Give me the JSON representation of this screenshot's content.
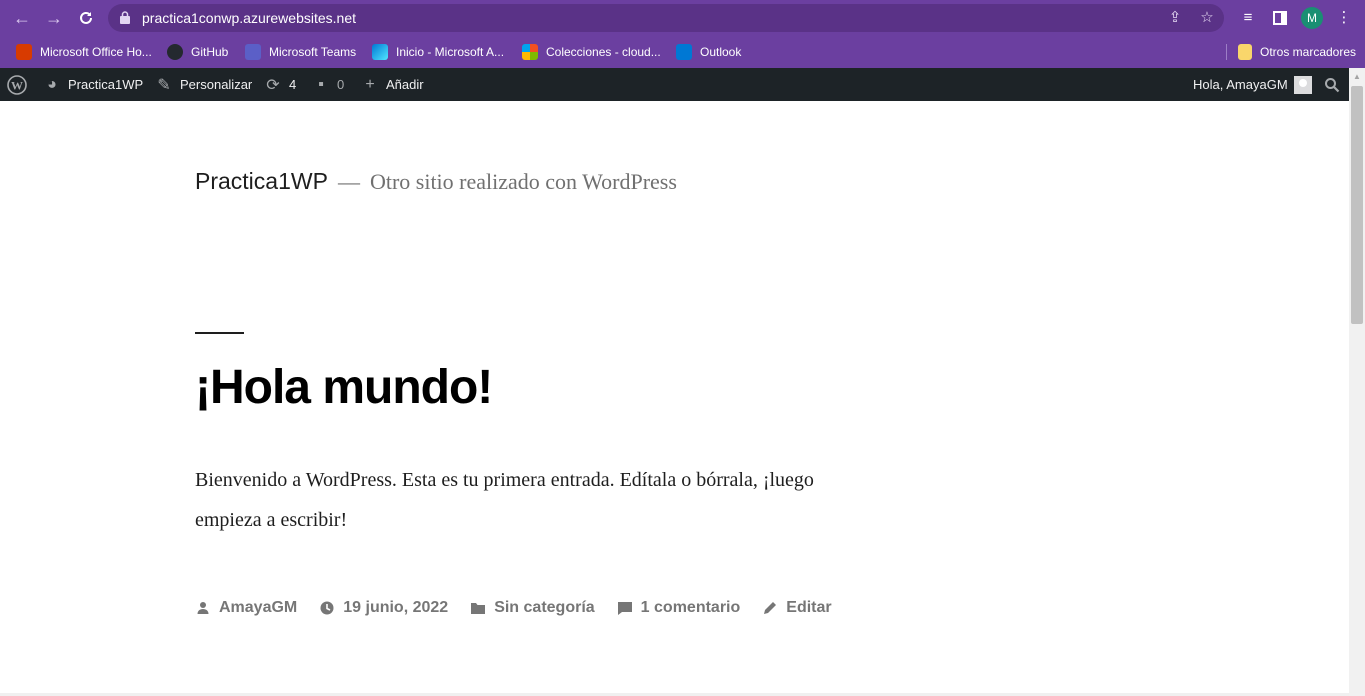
{
  "browser": {
    "url": "practica1conwp.azurewebsites.net",
    "profile_initial": "M",
    "bookmarks": [
      {
        "label": "Microsoft Office Ho..."
      },
      {
        "label": "GitHub"
      },
      {
        "label": "Microsoft Teams"
      },
      {
        "label": "Inicio - Microsoft A..."
      },
      {
        "label": "Colecciones - cloud..."
      },
      {
        "label": "Outlook"
      }
    ],
    "other_bookmarks": "Otros marcadores"
  },
  "adminbar": {
    "site_name": "Practica1WP",
    "customize": "Personalizar",
    "updates_count": "4",
    "comments_count": "0",
    "add_new": "Añadir",
    "greeting": "Hola, AmayaGM"
  },
  "site": {
    "title": "Practica1WP",
    "separator": "—",
    "description": "Otro sitio realizado con WordPress"
  },
  "post": {
    "title": "¡Hola mundo!",
    "body": "Bienvenido a WordPress. Esta es tu primera entrada. Edítala o bórrala, ¡luego empieza a escribir!",
    "author": "AmayaGM",
    "date": "19 junio, 2022",
    "category": "Sin categoría",
    "comments": "1 comentario",
    "edit": "Editar"
  },
  "colors": {
    "browser_frame": "#6b3fa0",
    "admin_bar": "#1d2327",
    "meta_text": "#767676"
  }
}
